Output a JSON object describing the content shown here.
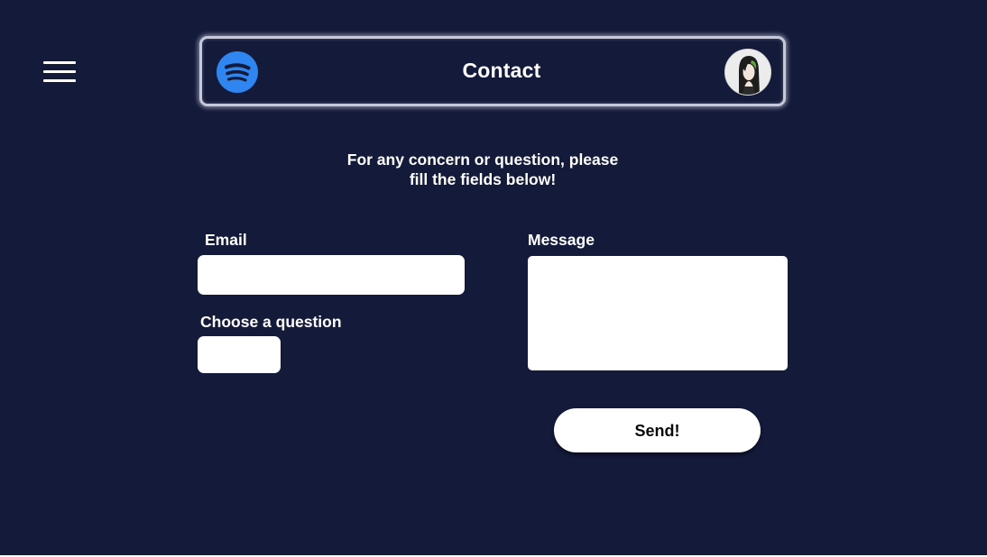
{
  "colors": {
    "background": "#141a3a",
    "accent": "#2f86f0",
    "text": "#ffffff",
    "field_background": "#ffffff",
    "header_border": "#c6c9d8"
  },
  "menu": {
    "icon": "hamburger-menu-icon"
  },
  "header": {
    "logo_icon": "spotify-logo",
    "title": "Contact",
    "avatar_icon": "user-avatar"
  },
  "intro": {
    "line1": "For any concern or question, please",
    "line2": "fill the fields below!"
  },
  "form": {
    "email_label": "Email",
    "email_value": "",
    "question_label": "Choose a question",
    "question_selected": "",
    "message_label": "Message",
    "message_value": "",
    "send_label": "Send!"
  }
}
